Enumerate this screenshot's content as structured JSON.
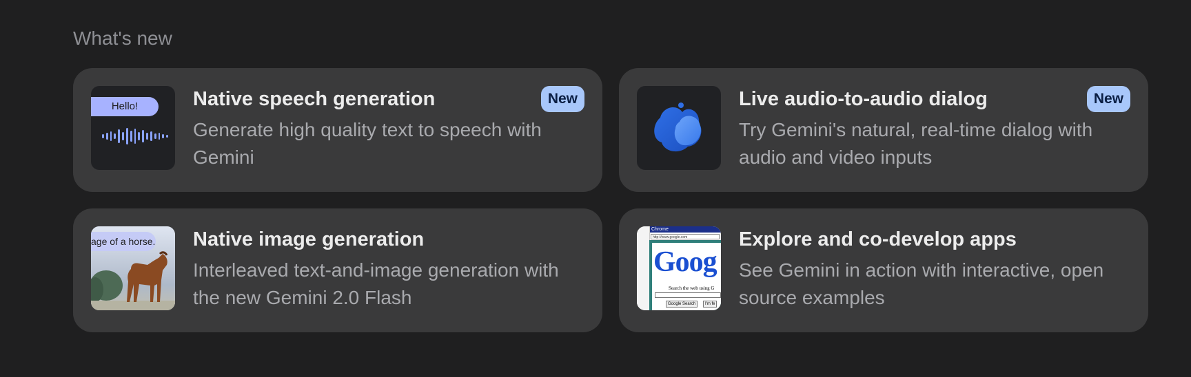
{
  "section": {
    "title": "What's new"
  },
  "cards": [
    {
      "title": "Native speech generation",
      "description": "Generate high quality text to speech with Gemini",
      "badge": "New",
      "thumbnail_text": "Hello!"
    },
    {
      "title": "Live audio-to-audio dialog",
      "description": "Try Gemini's natural, real-time dialog with audio and video inputs",
      "badge": "New"
    },
    {
      "title": "Native image generation",
      "description": "Interleaved text-and-image generation with the new Gemini 2.0 Flash",
      "thumbnail_text": "age of a horse."
    },
    {
      "title": "Explore and co-develop apps",
      "description": "See Gemini in action with interactive, open source examples",
      "thumbnail_text": "Chrome",
      "thumbnail_url": "http://www.google.com",
      "thumbnail_logo": "Goog",
      "thumbnail_caption": "Search the web using G",
      "thumbnail_button": "Google Search",
      "thumbnail_button2": "I'm fe"
    }
  ],
  "colors": {
    "background": "#1f1f20",
    "card": "#3a3a3b",
    "badge": "#a8c7fa",
    "title": "#ececec",
    "description": "#a9aaae"
  },
  "icons": {
    "speech": "waveform-icon",
    "dialog": "gemini-live-blob-icon",
    "image": "horse-photo-thumbnail",
    "apps": "browser-screenshot-thumbnail"
  }
}
